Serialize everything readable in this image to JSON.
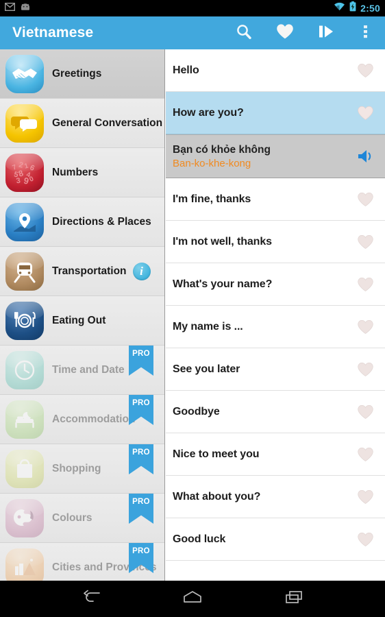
{
  "statusbar": {
    "time": "2:50",
    "icons": [
      "gmail-icon",
      "android-icon",
      "wifi-icon",
      "battery-charging-icon"
    ],
    "accent_color": "#5bc4e8"
  },
  "actionbar": {
    "title": "Vietnamese",
    "background_color": "#41a8dd",
    "actions": [
      {
        "name": "search-icon",
        "label": "Search"
      },
      {
        "name": "favorites-icon",
        "label": "Favorites"
      },
      {
        "name": "play-slideshow-icon",
        "label": "Play"
      },
      {
        "name": "overflow-menu-icon",
        "label": "More options"
      }
    ]
  },
  "sidebar": {
    "items": [
      {
        "label": "Greetings",
        "icon": "handshake-icon",
        "selected": true,
        "locked": false,
        "pro": false,
        "info": false
      },
      {
        "label": "General Conversation",
        "icon": "speech-bubbles-icon",
        "selected": false,
        "locked": false,
        "pro": false,
        "info": false
      },
      {
        "label": "Numbers",
        "icon": "numbers-icon",
        "selected": false,
        "locked": false,
        "pro": false,
        "info": false
      },
      {
        "label": "Directions & Places",
        "icon": "map-pin-icon",
        "selected": false,
        "locked": false,
        "pro": false,
        "info": false
      },
      {
        "label": "Transportation",
        "icon": "train-icon",
        "selected": false,
        "locked": false,
        "pro": false,
        "info": true,
        "info_label": "i"
      },
      {
        "label": "Eating Out",
        "icon": "cutlery-plate-icon",
        "selected": false,
        "locked": false,
        "pro": false,
        "info": false
      },
      {
        "label": "Time and Date",
        "icon": "clock-icon",
        "selected": false,
        "locked": true,
        "pro": true,
        "pro_label": "PRO",
        "info": false
      },
      {
        "label": "Accommodation",
        "icon": "bed-moon-icon",
        "selected": false,
        "locked": true,
        "pro": true,
        "pro_label": "PRO",
        "info": false
      },
      {
        "label": "Shopping",
        "icon": "shopping-bag-icon",
        "selected": false,
        "locked": true,
        "pro": true,
        "pro_label": "PRO",
        "info": false
      },
      {
        "label": "Colours",
        "icon": "palette-brush-icon",
        "selected": false,
        "locked": true,
        "pro": true,
        "pro_label": "PRO",
        "info": false
      },
      {
        "label": "Cities and Provinces",
        "icon": "cityscape-icon",
        "selected": false,
        "locked": true,
        "pro": true,
        "pro_label": "PRO",
        "info": false
      }
    ]
  },
  "phrases": [
    {
      "text": "Hello",
      "state": "normal",
      "trailing": "heart-icon"
    },
    {
      "text": "How are you?",
      "state": "active",
      "trailing": "heart-icon"
    },
    {
      "text": "Bạn có khỏe không",
      "phonetic": "Ban-ko-khe-kong",
      "state": "translation",
      "trailing": "speaker-icon"
    },
    {
      "text": "I'm fine, thanks",
      "state": "normal",
      "trailing": "heart-icon"
    },
    {
      "text": "I'm not well, thanks",
      "state": "normal",
      "trailing": "heart-icon"
    },
    {
      "text": "What's your name?",
      "state": "normal",
      "trailing": "heart-icon"
    },
    {
      "text": "My name is ...",
      "state": "normal",
      "trailing": "heart-icon"
    },
    {
      "text": "See you later",
      "state": "normal",
      "trailing": "heart-icon"
    },
    {
      "text": "Goodbye",
      "state": "normal",
      "trailing": "heart-icon"
    },
    {
      "text": "Nice to meet you",
      "state": "normal",
      "trailing": "heart-icon"
    },
    {
      "text": "What about you?",
      "state": "normal",
      "trailing": "heart-icon"
    },
    {
      "text": "Good luck",
      "state": "normal",
      "trailing": "heart-icon"
    }
  ],
  "navbar": {
    "buttons": [
      {
        "name": "back-button",
        "label": "Back"
      },
      {
        "name": "home-button",
        "label": "Home"
      },
      {
        "name": "recents-button",
        "label": "Recents"
      }
    ]
  },
  "colors": {
    "accent": "#41a8dd",
    "active_row": "#b5dcf0",
    "translation_row": "#c9c9c9",
    "phonetic_text": "#f08a21",
    "pro_badge": "#3ba3dd"
  }
}
